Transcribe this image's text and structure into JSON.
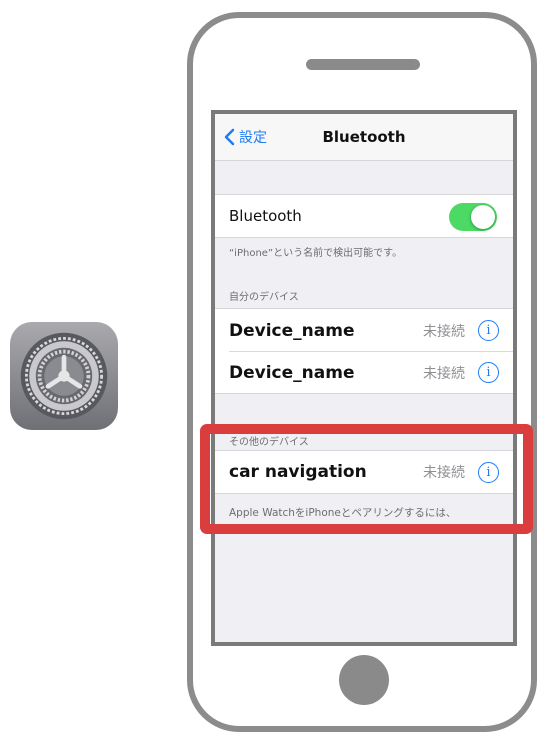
{
  "nav": {
    "back_label": "設定",
    "title": "Bluetooth"
  },
  "bluetooth_toggle": {
    "label": "Bluetooth",
    "state": "on",
    "color": "#4cd964"
  },
  "visibility_note": "“iPhone”という名前で検出可能です。",
  "my_devices": {
    "header": "自分のデバイス",
    "items": [
      {
        "name": "Device_name",
        "status": "未接続",
        "info_icon": "i"
      },
      {
        "name": "Device_name",
        "status": "未接続",
        "info_icon": "i"
      }
    ]
  },
  "other_devices": {
    "header": "その他のデバイス",
    "items": [
      {
        "name": "car navigation",
        "status": "未接続",
        "info_icon": "i"
      }
    ],
    "footer": "Apple WatchをiPhoneとペアリングするには、"
  },
  "colors": {
    "accent": "#1f7cf5",
    "highlight": "#d93d3d"
  }
}
